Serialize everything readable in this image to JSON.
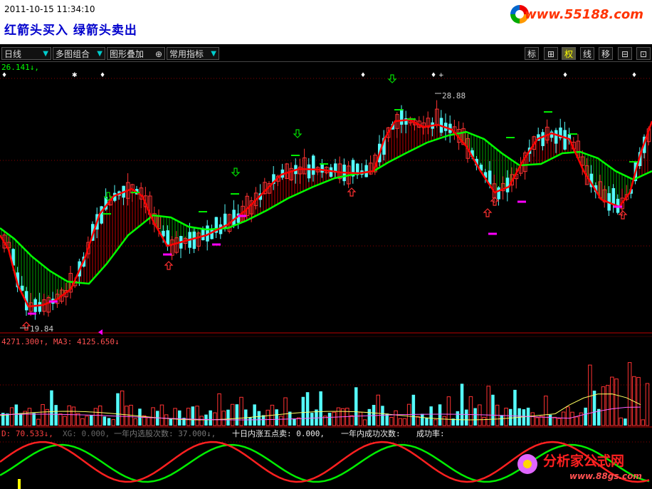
{
  "banner": {
    "timestamp": "2011-10-15 11:34:10",
    "caption": "红箭头买入 绿箭头卖出",
    "site": "www.55188.com"
  },
  "toolbar": {
    "left": [
      {
        "label": "日线"
      },
      {
        "label": "多图组合"
      },
      {
        "label": "图形叠加"
      },
      {
        "label": "常用指标"
      }
    ],
    "right": [
      "标",
      "⊞",
      "权",
      "线",
      "移",
      "⊟",
      "⊡"
    ]
  },
  "main_panel": {
    "top_value": "26.141↓,",
    "high_label": "28.88",
    "low_label": "19.84"
  },
  "volume_panel": {
    "label": "4271.300↑, MA3: 4125.650↓"
  },
  "kdj_panel": {
    "d_label": "D: 70.533↓,",
    "xg_label": "XG: 0.000,",
    "count_label": "一年内选股次数: 37.000↓,",
    "rise_label": "十日内涨五点卖: 0.000,",
    "success_count_label": "一年内成功次数:",
    "success_rate_label": "成功率:"
  },
  "watermark": {
    "title": "分析家公式网",
    "url": "www.88gs.com"
  },
  "colors": {
    "up": "#ff3232",
    "down": "#54fcfc",
    "ma_fast": "#ff0000",
    "ma_slow": "#00ff00",
    "highlight": "#ff00ff"
  }
}
